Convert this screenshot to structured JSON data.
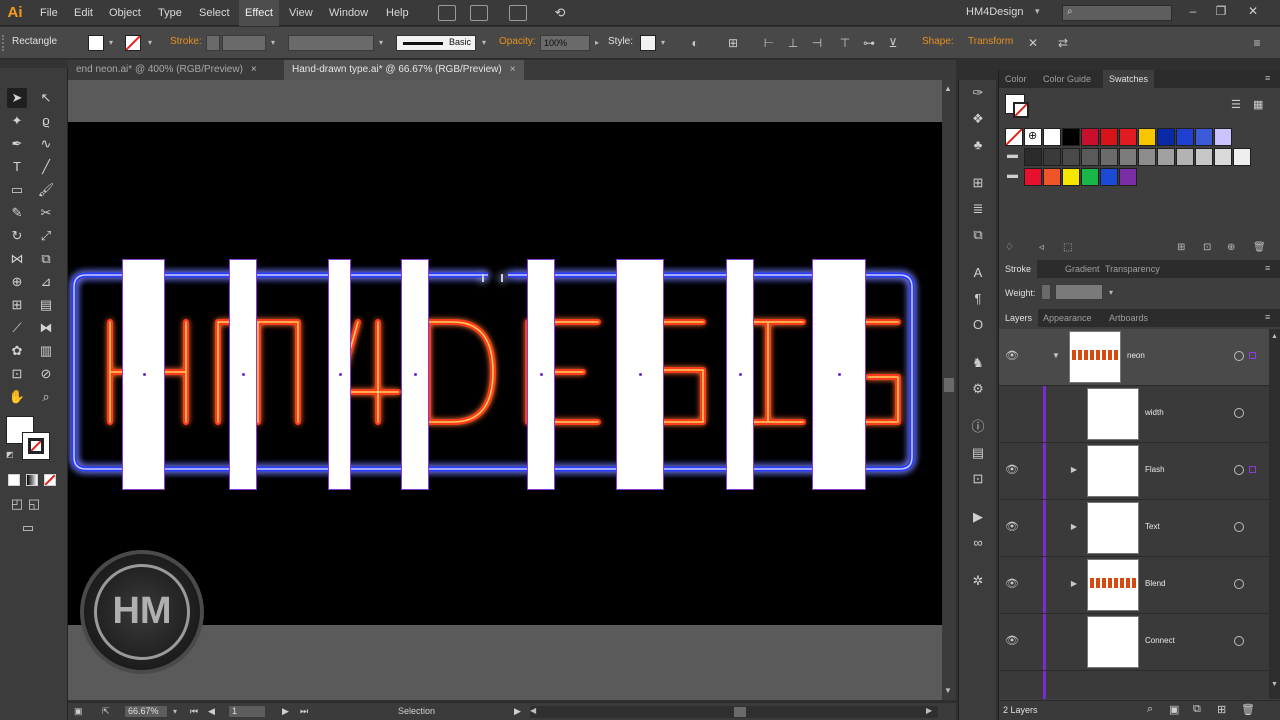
{
  "app": {
    "logo": "Ai",
    "workspace": "HM4Design",
    "menu": [
      "File",
      "Edit",
      "Object",
      "Type",
      "Select",
      "Effect",
      "View",
      "Window",
      "Help"
    ],
    "active_menu": "Effect",
    "search_placeholder": ""
  },
  "control_bar": {
    "tool_name": "Rectangle",
    "stroke_label": "Stroke:",
    "brush_label": "Basic",
    "opacity_label": "Opacity:",
    "opacity_value": "100%",
    "style_label": "Style:",
    "shape_label": "Shape:",
    "transform_label": "Transform"
  },
  "doc_tabs": [
    {
      "label": "end neon.ai* @ 400% (RGB/Preview)",
      "active": false
    },
    {
      "label": "Hand-drawn type.ai* @ 66.67% (RGB/Preview)",
      "active": true
    }
  ],
  "artwork": {
    "neon_text": "HM4DESIGN",
    "watermark": "HM",
    "colors": {
      "neon_red": "#ff3a1f",
      "neon_yellow": "#ffd15c",
      "neon_blue": "#2a3cff",
      "slice_outline": "#8a3cd6"
    }
  },
  "status_bar": {
    "zoom": "66.67%",
    "page": "1",
    "tool": "Selection"
  },
  "panels": {
    "top_tabs": [
      "Color",
      "Color Guide",
      "Swatches"
    ],
    "active_top_tab": "Swatches",
    "stroke_tabs": [
      "Stroke",
      "Gradient",
      "Transparency"
    ],
    "active_stroke_tab": "Stroke",
    "weight_label": "Weight:",
    "layers_tabs": [
      "Layers",
      "Appearance",
      "Artboards"
    ],
    "active_layers_tab": "Layers",
    "layers": [
      {
        "name": "neon",
        "visible": true,
        "expandable": "expanded"
      },
      {
        "name": "width",
        "visible": false,
        "expandable": "none"
      },
      {
        "name": "Flash",
        "visible": true,
        "expandable": "collapsed"
      },
      {
        "name": "Text",
        "visible": true,
        "expandable": "collapsed"
      },
      {
        "name": "Blend",
        "visible": true,
        "expandable": "collapsed"
      },
      {
        "name": "Connect",
        "visible": true,
        "expandable": "none"
      }
    ],
    "layers_count": "2 Layers",
    "swatch_row1": [
      "#ffffff",
      "#000000",
      "#c8102e",
      "#d7141a",
      "#e11b22",
      "#f6c700",
      "#0a2aa5",
      "#1f3fd1",
      "#3b5bd9",
      "#c9c3ff"
    ],
    "swatch_row2": [
      "#2b2b2b",
      "#3a3a3a",
      "#4a4a4a",
      "#5a5a5a",
      "#6b6b6b",
      "#7c7c7c",
      "#8d8d8d",
      "#a0a0a0",
      "#b3b3b3",
      "#c7c7c7",
      "#dadada",
      "#eeeeee"
    ],
    "swatch_row3": [
      "#e8112d",
      "#f0552a",
      "#f6e600",
      "#19b64a",
      "#1b4bd6",
      "#7b2da6"
    ]
  }
}
